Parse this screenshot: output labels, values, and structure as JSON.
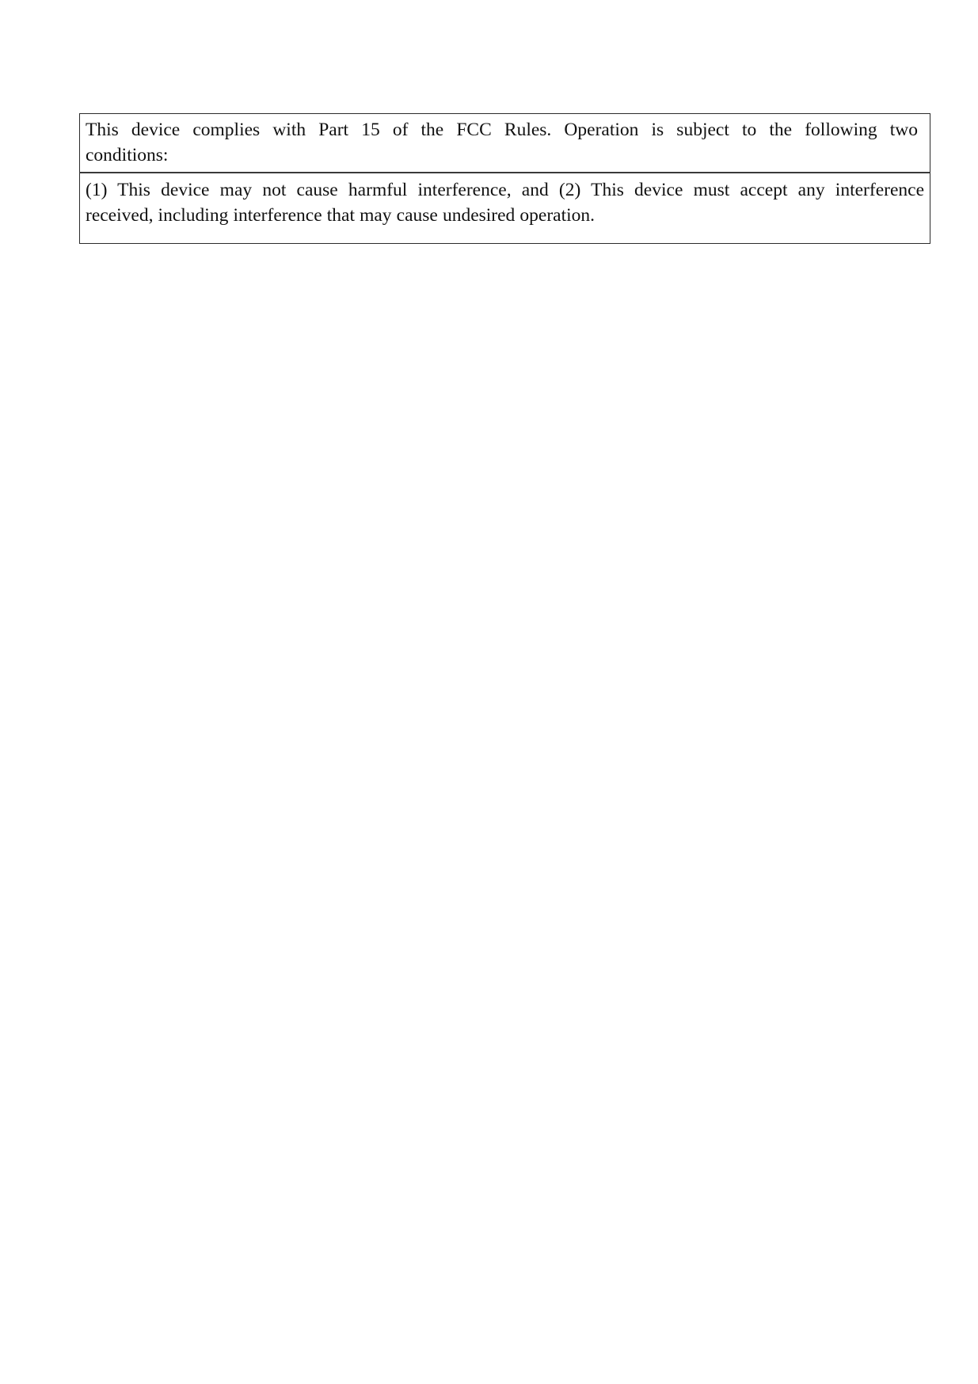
{
  "document": {
    "notice_table": {
      "rows": [
        {
          "id": "fcc-compliance-statement",
          "lines": [
            "This device complies with Part 15 of the FCC Rules. Operation is subject to the following two",
            "conditions:"
          ],
          "full_text": "This device complies with Part 15 of the FCC Rules. Operation is subject to the following two conditions:"
        },
        {
          "id": "fcc-operating-conditions",
          "lines": [
            "(1) This device may not cause harmful interference, and (2) This device must accept any interference",
            "received, including interference that may cause undesired operation."
          ],
          "full_text": "(1) This device may not cause harmful interference, and (2) This device must accept any interference received, including interference that may cause undesired operation."
        }
      ]
    }
  },
  "colors": {
    "page_background": "#ffffff",
    "text": "#111111",
    "table_border": "#2b2b2b",
    "row_divider": "#3a3a3a"
  }
}
